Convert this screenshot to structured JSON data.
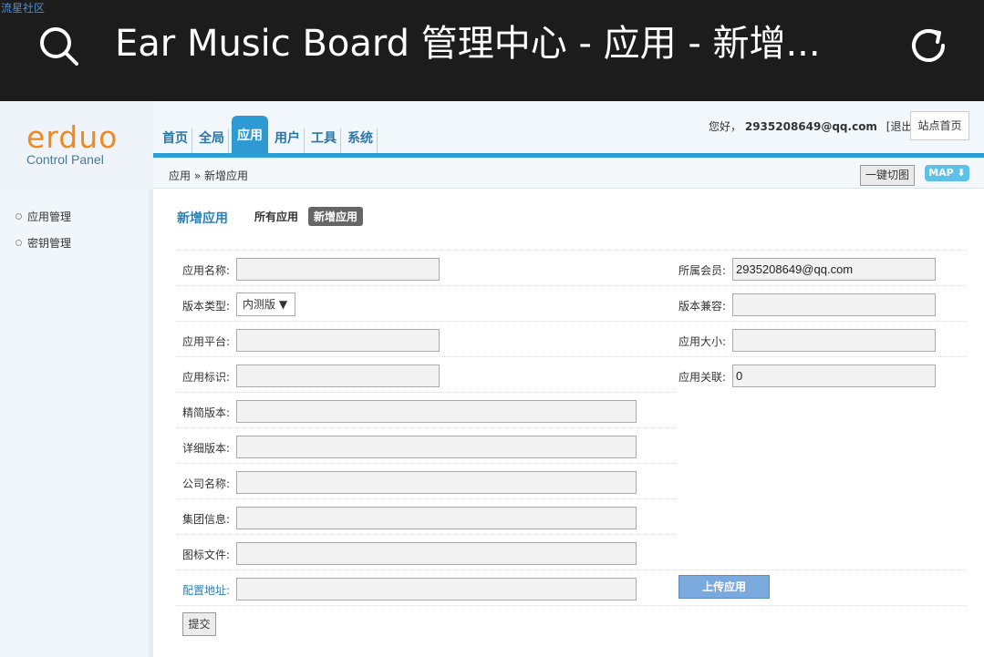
{
  "browser": {
    "watermark": "流星社区",
    "title": "Ear Music Board 管理中心 - 应用 - 新增..."
  },
  "logo": {
    "main": "erduo",
    "sub": "Control Panel"
  },
  "nav": {
    "items": [
      "首页",
      "全局",
      "应用",
      "用户",
      "工具",
      "系统"
    ],
    "active": "应用"
  },
  "header": {
    "greeting_prefix": "您好，",
    "user_email": "2935208649@qq.com",
    "logout": "[退出]",
    "home_label": "站点首页"
  },
  "crumb": {
    "text": "应用 » 新增应用",
    "cut_label": "一键切图",
    "map_label": "MAP ⬇"
  },
  "sidebar": {
    "items": [
      "应用管理",
      "密钥管理"
    ]
  },
  "main": {
    "title": "新增应用",
    "tabs": [
      "所有应用",
      "新增应用"
    ],
    "fields": {
      "app_name": {
        "label": "应用名称:",
        "value": ""
      },
      "member": {
        "label": "所属会员:",
        "value": "2935208649@qq.com"
      },
      "version_type": {
        "label": "版本类型:",
        "value": "内测版 ▼"
      },
      "compat": {
        "label": "版本兼容:",
        "value": ""
      },
      "platform": {
        "label": "应用平台:",
        "value": ""
      },
      "size": {
        "label": "应用大小:",
        "value": ""
      },
      "identifier": {
        "label": "应用标识:",
        "value": ""
      },
      "relation": {
        "label": "应用关联:",
        "value": "0"
      },
      "short_version": {
        "label": "精简版本:",
        "value": ""
      },
      "detail_version": {
        "label": "详细版本:",
        "value": ""
      },
      "company": {
        "label": "公司名称:",
        "value": ""
      },
      "group": {
        "label": "集团信息:",
        "value": ""
      },
      "icon_file": {
        "label": "图标文件:",
        "value": ""
      },
      "config_url": {
        "label": "配置地址:",
        "value": ""
      }
    },
    "upload_label": "上传应用",
    "submit_label": "提交"
  },
  "colors": {
    "accent": "#2a9fd6",
    "logo": "#f08a1e",
    "link": "#2a80b9"
  }
}
